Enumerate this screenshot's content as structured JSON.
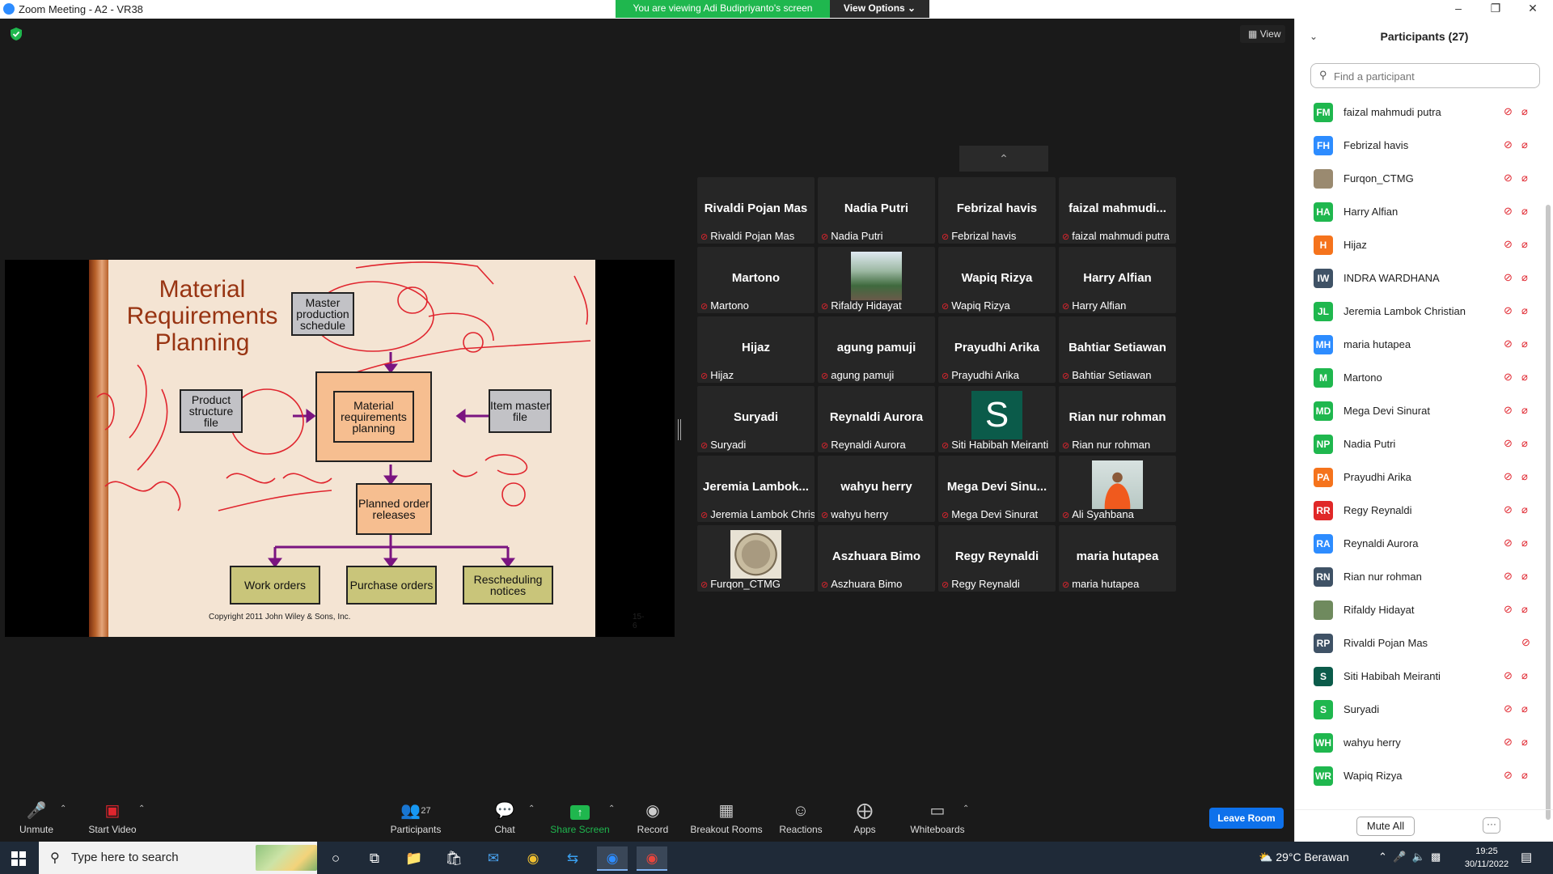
{
  "window": {
    "title": "Zoom Meeting - A2 - VR38",
    "viewing_banner": "You are viewing Adi Budipriyanto's screen",
    "view_options_label": "View Options ⌄",
    "minimize": "–",
    "maximize": "❐",
    "close": "✕"
  },
  "stage": {
    "view_label": "View",
    "collapse_label": "⌃"
  },
  "slide": {
    "title": "Material Requirements Planning",
    "boxes": {
      "mps": "Master production schedule",
      "psf": "Product structure file",
      "mrp": "Material requirements planning",
      "imf": "Item master file",
      "por": "Planned order releases",
      "wo": "Work orders",
      "po": "Purchase orders",
      "rn": "Rescheduling notices"
    },
    "copyright": "Copyright 2011 John Wiley & Sons, Inc.",
    "page": "15-6"
  },
  "gallery": [
    {
      "name": "Rivaldi Pojan Mas",
      "label": "Rivaldi Pojan Mas",
      "kind": "text"
    },
    {
      "name": "Nadia Putri",
      "label": "Nadia Putri",
      "kind": "text"
    },
    {
      "name": "Febrizal havis",
      "label": "Febrizal havis",
      "kind": "text"
    },
    {
      "name": "faizal  mahmudi...",
      "label": "faizal mahmudi putra",
      "kind": "text"
    },
    {
      "name": "Martono",
      "label": "Martono",
      "kind": "text"
    },
    {
      "name": "",
      "label": "Rifaldy Hidayat",
      "kind": "photo-landscape"
    },
    {
      "name": "Wapiq Rizya",
      "label": "Wapiq Rizya",
      "kind": "text"
    },
    {
      "name": "Harry Alfian",
      "label": "Harry Alfian",
      "kind": "text"
    },
    {
      "name": "Hijaz",
      "label": "Hijaz",
      "kind": "text"
    },
    {
      "name": "agung pamuji",
      "label": "agung pamuji",
      "kind": "text"
    },
    {
      "name": "Prayudhi Arika",
      "label": "Prayudhi Arika",
      "kind": "text"
    },
    {
      "name": "Bahtiar Setiawan",
      "label": "Bahtiar Setiawan",
      "kind": "text"
    },
    {
      "name": "Suryadi",
      "label": "Suryadi",
      "kind": "text"
    },
    {
      "name": "Reynaldi Aurora",
      "label": "Reynaldi Aurora",
      "kind": "text"
    },
    {
      "name": "S",
      "label": "Siti Habibah Meiranti",
      "kind": "initial"
    },
    {
      "name": "Rian nur rohman",
      "label": "Rian nur rohman",
      "kind": "text"
    },
    {
      "name": "Jeremia  Lambok...",
      "label": "Jeremia Lambok Christian",
      "kind": "text"
    },
    {
      "name": "wahyu herry",
      "label": "wahyu herry",
      "kind": "text"
    },
    {
      "name": "Mega  Devi  Sinu...",
      "label": "Mega Devi Sinurat",
      "kind": "text"
    },
    {
      "name": "",
      "label": "Ali Syahbana",
      "kind": "photo-person"
    },
    {
      "name": "",
      "label": "Furqon_CTMG",
      "kind": "photo-seal"
    },
    {
      "name": "Aszhuara Bimo",
      "label": "Aszhuara Bimo",
      "kind": "text"
    },
    {
      "name": "Regy Reynaldi",
      "label": "Regy Reynaldi",
      "kind": "text"
    },
    {
      "name": "maria hutapea",
      "label": "maria hutapea",
      "kind": "text"
    }
  ],
  "toolbar": {
    "unmute": "Unmute",
    "start_video": "Start Video",
    "participants": "Participants",
    "participants_count": "27",
    "chat": "Chat",
    "share_screen": "Share Screen",
    "record": "Record",
    "breakout_rooms": "Breakout Rooms",
    "reactions": "Reactions",
    "apps": "Apps",
    "whiteboards": "Whiteboards",
    "leave": "Leave Room"
  },
  "panel": {
    "title": "Participants (27)",
    "search_placeholder": "Find a participant",
    "mute_all": "Mute All",
    "more": "···",
    "participants": [
      {
        "initials": "FM",
        "name": "faizal mahmudi putra",
        "color": "#1fb74e",
        "cam": true
      },
      {
        "initials": "FH",
        "name": "Febrizal havis",
        "color": "#2d8cff",
        "cam": true
      },
      {
        "initials": "",
        "name": "Furqon_CTMG",
        "color": "#9a8a70",
        "cam": true
      },
      {
        "initials": "HA",
        "name": "Harry Alfian",
        "color": "#1fb74e",
        "cam": true
      },
      {
        "initials": "H",
        "name": "Hijaz",
        "color": "#f5731c",
        "cam": true
      },
      {
        "initials": "IW",
        "name": "INDRA WARDHANA",
        "color": "#3f5266",
        "cam": true
      },
      {
        "initials": "JL",
        "name": "Jeremia Lambok Christian",
        "color": "#1fb74e",
        "cam": true
      },
      {
        "initials": "MH",
        "name": "maria hutapea",
        "color": "#2d8cff",
        "cam": true
      },
      {
        "initials": "M",
        "name": "Martono",
        "color": "#1fb74e",
        "cam": true
      },
      {
        "initials": "MD",
        "name": "Mega Devi Sinurat",
        "color": "#1fb74e",
        "cam": true
      },
      {
        "initials": "NP",
        "name": "Nadia Putri",
        "color": "#1fb74e",
        "cam": true
      },
      {
        "initials": "PA",
        "name": "Prayudhi Arika",
        "color": "#f5731c",
        "cam": true
      },
      {
        "initials": "RR",
        "name": "Regy Reynaldi",
        "color": "#e02828",
        "cam": true
      },
      {
        "initials": "RA",
        "name": "Reynaldi Aurora",
        "color": "#2d8cff",
        "cam": true
      },
      {
        "initials": "RN",
        "name": "Rian nur rohman",
        "color": "#3f5266",
        "cam": true
      },
      {
        "initials": "",
        "name": "Rifaldy Hidayat",
        "color": "#6f8a5e",
        "cam": true
      },
      {
        "initials": "RP",
        "name": "Rivaldi Pojan Mas",
        "color": "#3f5266",
        "cam": false
      },
      {
        "initials": "S",
        "name": "Siti Habibah Meiranti",
        "color": "#0b5b4a",
        "cam": true
      },
      {
        "initials": "S",
        "name": "Suryadi",
        "color": "#1fb74e",
        "cam": true
      },
      {
        "initials": "WH",
        "name": "wahyu herry",
        "color": "#1fb74e",
        "cam": true
      },
      {
        "initials": "WR",
        "name": "Wapiq Rizya",
        "color": "#1fb74e",
        "cam": true
      }
    ]
  },
  "taskbar": {
    "search_placeholder": "Type here to search",
    "weather": "29°C  Berawan",
    "time": "19:25",
    "date": "30/11/2022"
  },
  "colors": {
    "accent_blue": "#0e71eb",
    "share_green": "#1fb74e",
    "muted_red": "#e0252e"
  }
}
